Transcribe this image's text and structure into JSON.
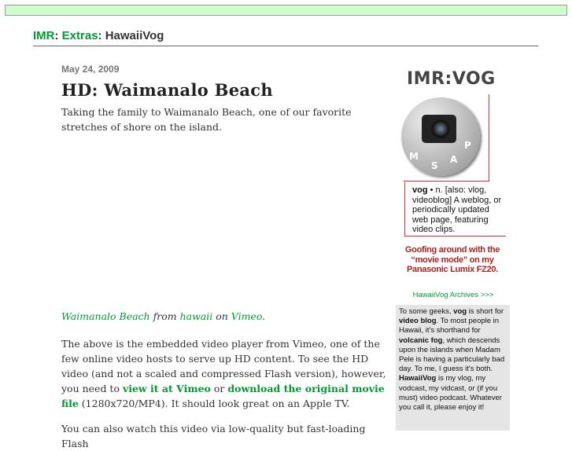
{
  "header": {
    "crumb1": "IMR",
    "crumb2": "Extras",
    "crumb3": "HawaiiVog"
  },
  "post": {
    "date": "May 24, 2009",
    "title": "HD: Waimanalo Beach",
    "intro": "Taking the family to Waimanalo Beach, one of our favorite stretches of shore on the island.",
    "credit_link1": "Waimanalo Beach",
    "credit_from": "from",
    "credit_link2": "hawaii",
    "credit_on": "on",
    "credit_link3": "Vimeo",
    "para2_a": "The above is the embedded video player from Vimeo, one of the few online video hosts to serve up HD content. To see the HD video (and not a scaled and compressed Flash version), however, you need to",
    "para2_link1": "view it at Vimeo",
    "para2_or": "or",
    "para2_link2": "download the original movie file",
    "para2_b": "(1280x720/MP4). It should look great on an Apple TV.",
    "para3": "You can also watch this video via low-quality but fast-loading Flash"
  },
  "sidebar": {
    "logo_title": "IMR:VOG",
    "dial_glyphs": [
      "M",
      "S",
      "A",
      "P"
    ],
    "defn_term": "vog",
    "defn_text": " • n. [also: vlog, videoblog] A weblog, or periodically updated web page, featuring video clips.",
    "goof_text": "Goofing around with the “movie mode” on my Panasonic Lumix FZ20.",
    "archives_link": "HawaiiVog Archives >>>",
    "box_text_1": "To some geeks, ",
    "box_vog": "vog",
    "box_text_2": " is short for ",
    "box_video_blog": "video blog",
    "box_text_3": ". To most people in Hawaii, it's shorthand for ",
    "box_volcanic": "volcanic fog",
    "box_text_4": ", which descends upon the islands when Madam Pele is having a particularly bad day. To me, I guess it's both. ",
    "box_hawaiivog": "HawaiiVog",
    "box_text_5": " is my vlog, my vodcast, my vidcast, or (if you must) video podcast. Whatever you call it, please enjoy it!"
  },
  "colors": {
    "link_green": "#009933",
    "topbar_green": "#ccffcc",
    "accent_red": "#cc3333"
  }
}
